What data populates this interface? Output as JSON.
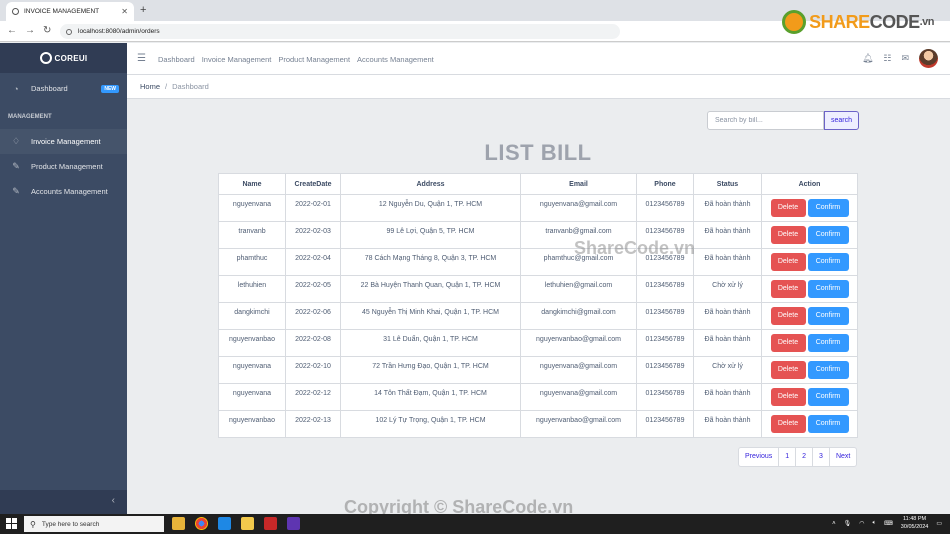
{
  "browser": {
    "tab_title": "INVOICE MANAGEMENT",
    "new_tab": "+",
    "url": "localhost:8080/admin/orders",
    "watermark_logo": {
      "part1": "SHARE",
      "part2": "CODE",
      "part3": ".vn"
    }
  },
  "sidebar": {
    "brand": "COREUI",
    "dashboard": {
      "label": "Dashboard",
      "badge": "NEW"
    },
    "section_title": "MANAGEMENT",
    "items": [
      {
        "label": "Invoice Management",
        "icon": "drop-icon"
      },
      {
        "label": "Product Management",
        "icon": "pencil-icon"
      },
      {
        "label": "Accounts Management",
        "icon": "pencil-icon"
      }
    ],
    "toggler": "‹"
  },
  "header": {
    "nav": [
      "Dashboard",
      "Invoice Management",
      "Product Management",
      "Accounts Management"
    ]
  },
  "breadcrumb": {
    "home": "Home",
    "current": "Dashboard"
  },
  "search": {
    "placeholder": "Search by bill...",
    "button": "search"
  },
  "page_title": "LIST BILL",
  "table": {
    "headers": [
      "Name",
      "CreateDate",
      "Address",
      "Email",
      "Phone",
      "Status",
      "Action"
    ],
    "delete_label": "Delete",
    "confirm_label": "Confirm",
    "rows": [
      [
        "nguyenvana",
        "2022-02-01",
        "12 Nguyễn Du, Quận 1, TP. HCM",
        "nguyenvana@gmail.com",
        "0123456789",
        "Đã hoàn thành"
      ],
      [
        "tranvanb",
        "2022-02-03",
        "99 Lê Lợi, Quận 5, TP. HCM",
        "tranvanb@gmail.com",
        "0123456789",
        "Đã hoàn thành"
      ],
      [
        "phamthuc",
        "2022-02-04",
        "78 Cách Mạng Tháng 8, Quận 3, TP. HCM",
        "phamthuc@gmail.com",
        "0123456789",
        "Đã hoàn thành"
      ],
      [
        "lethuhien",
        "2022-02-05",
        "22 Bà Huyện Thanh Quan, Quận 1, TP. HCM",
        "lethuhien@gmail.com",
        "0123456789",
        "Chờ xử lý"
      ],
      [
        "dangkimchi",
        "2022-02-06",
        "45 Nguyễn Thị Minh Khai, Quận 1, TP. HCM",
        "dangkimchi@gmail.com",
        "0123456789",
        "Đã hoàn thành"
      ],
      [
        "nguyenvanbao",
        "2022-02-08",
        "31 Lê Duẩn, Quận 1, TP. HCM",
        "nguyenvanbao@gmail.com",
        "0123456789",
        "Đã hoàn thành"
      ],
      [
        "nguyenvana",
        "2022-02-10",
        "72 Trần Hưng Đạo, Quận 1, TP. HCM",
        "nguyenvana@gmail.com",
        "0123456789",
        "Chờ xử lý"
      ],
      [
        "nguyenvana",
        "2022-02-12",
        "14 Tôn Thất Đạm, Quận 1, TP. HCM",
        "nguyenvana@gmail.com",
        "0123456789",
        "Đã hoàn thành"
      ],
      [
        "nguyenvanbao",
        "2022-02-13",
        "102 Lý Tự Trọng, Quận 1, TP. HCM",
        "nguyenvanbao@gmail.com",
        "0123456789",
        "Đã hoàn thành"
      ]
    ]
  },
  "pagination": [
    "Previous",
    "1",
    "2",
    "3",
    "Next"
  ],
  "watermarks": {
    "center": "ShareCode.vn",
    "bottom": "Copyright © ShareCode.vn"
  },
  "taskbar": {
    "search_placeholder": "Type here to search",
    "time": "11:48 PM",
    "date": "30/05/2024"
  }
}
